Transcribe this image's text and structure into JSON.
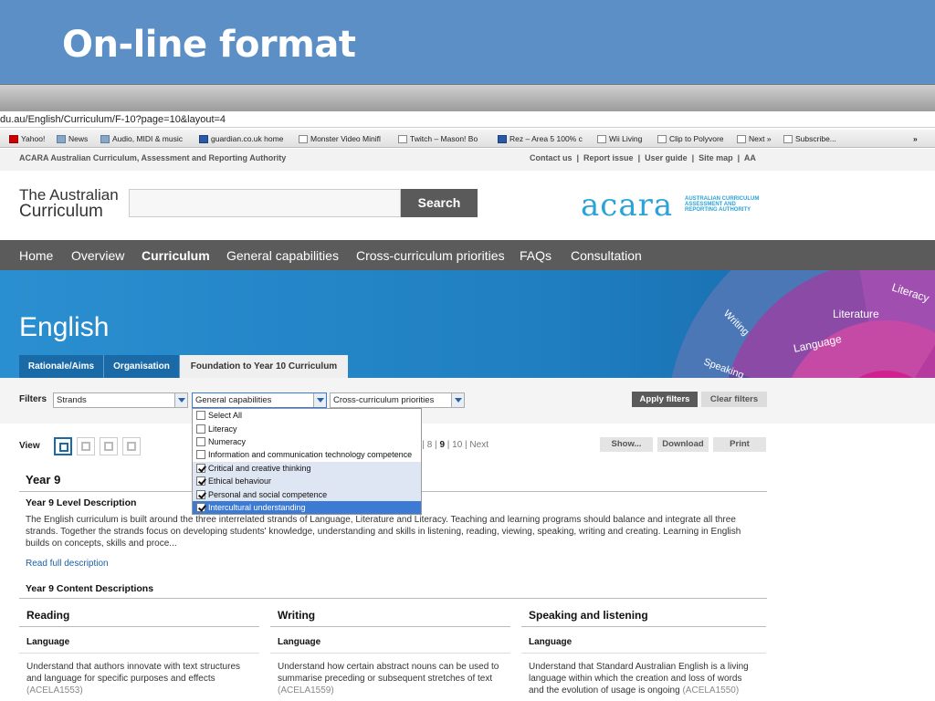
{
  "slide": {
    "title": "On-line format"
  },
  "browser": {
    "url": "du.au/English/Curriculum/F-10?page=10&layout=4",
    "bookmarks": [
      {
        "label": "Yahoo!",
        "icon": "yahoo-icon"
      },
      {
        "label": "News",
        "icon": "folder-icon"
      },
      {
        "label": "Audio, MIDI & music",
        "icon": "folder-icon"
      },
      {
        "label": "guardian.co.uk home",
        "icon": "guardian-icon"
      },
      {
        "label": "Monster Video Minifl",
        "icon": "page-icon"
      },
      {
        "label": "Twitch – Mason! Bo",
        "icon": "page-icon"
      },
      {
        "label": "Rez – Area 5 100% c",
        "icon": "google-icon"
      },
      {
        "label": "Wii Living",
        "icon": "page-icon"
      },
      {
        "label": "Clip to Polyvore",
        "icon": "page-icon"
      },
      {
        "label": "Next »",
        "icon": "page-icon"
      },
      {
        "label": "Subscribe...",
        "icon": "page-icon"
      }
    ],
    "overflow": "»"
  },
  "site": {
    "org_name": "ACARA Australian Curriculum, Assessment and Reporting Authority",
    "util_links": [
      "Contact us",
      "Report issue",
      "User guide",
      "Site map",
      "AA"
    ],
    "logo_line1": "The Australian",
    "logo_line2": "Curriculum",
    "search_label": "Search",
    "search_placeholder": "",
    "acara_word": "acara",
    "acara_sub1": "AUSTRALIAN CURRICULUM",
    "acara_sub2": "ASSESSMENT AND",
    "acara_sub3": "REPORTING AUTHORITY",
    "nav": [
      "Home",
      "Overview",
      "Curriculum",
      "General capabilities",
      "Cross-curriculum priorities",
      "FAQs",
      "Consultation"
    ],
    "active_nav": "Curriculum"
  },
  "banner": {
    "title": "English",
    "wheel_labels": [
      "Literacy",
      "Literature",
      "Language",
      "Writing",
      "Speaking"
    ],
    "tabs": [
      "Rationale/Aims",
      "Organisation",
      "Foundation to Year 10 Curriculum"
    ]
  },
  "filters": {
    "label": "Filters",
    "strands": "Strands",
    "general": "General capabilities",
    "cross": "Cross-curriculum priorities",
    "apply": "Apply filters",
    "clear": "Clear filters",
    "options": [
      {
        "label": "Select All",
        "checked": false
      },
      {
        "label": "Literacy",
        "checked": false
      },
      {
        "label": "Numeracy",
        "checked": false
      },
      {
        "label": "Information and communication technology competence",
        "checked": false
      },
      {
        "label": "Critical and creative thinking",
        "checked": true
      },
      {
        "label": "Ethical behaviour",
        "checked": true
      },
      {
        "label": "Personal and social competence",
        "checked": true
      },
      {
        "label": "Intercultural understanding",
        "checked": true
      }
    ]
  },
  "view": {
    "label": "View",
    "pager_prefix": "7 | 8 | ",
    "pager_current": "9",
    "pager_suffix": " | 10 | Next",
    "show": "Show...",
    "download": "Download",
    "print": "Print"
  },
  "content": {
    "year": "Year 9",
    "level_heading": "Year 9 Level Description",
    "level_text": "The English curriculum is built around the three interrelated strands of Language, Literature and Literacy. Teaching and learning programs should balance and integrate all three strands. Together the strands focus on developing students' knowledge, understanding and skills in listening, reading, viewing, speaking, writing and creating. Learning in English builds on concepts, skills and proce...",
    "read_more": "Read full description",
    "cd_heading": "Year 9 Content Descriptions",
    "columns": [
      {
        "title": "Reading",
        "sub": "Language",
        "text": "Understand that authors innovate with text structures and language for specific purposes and effects",
        "code": "(ACELA1553)"
      },
      {
        "title": "Writing",
        "sub": "Language",
        "text": "Understand how certain abstract nouns can be used to summarise preceding or subsequent stretches of text",
        "code": "(ACELA1559)"
      },
      {
        "title": "Speaking and listening",
        "sub": "Language",
        "text": "Understand that Standard Australian English is a living language within which the creation and loss of words and the evolution of usage is ongoing",
        "code": "(ACELA1550)"
      }
    ]
  },
  "colors": {
    "slide_blue": "#5b8fc6",
    "nav_grey": "#5b5b5b",
    "banner_blue": "#1f7ec0",
    "acara_blue": "#2aa3d8",
    "highlight": "#3d7ad4"
  }
}
